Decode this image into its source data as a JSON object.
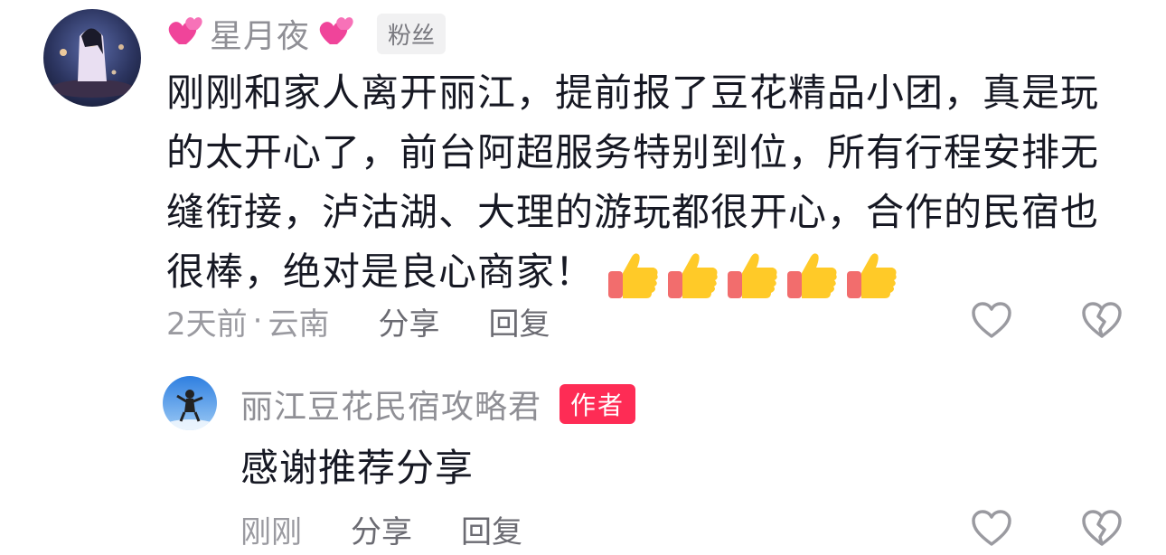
{
  "comment": {
    "username": "星月夜",
    "fan_badge": "粉丝",
    "text": "刚刚和家人离开丽江，提前报了豆花精品小团，真是玩的太开心了，前台阿超服务特别到位，所有行程安排无缝衔接，泸沽湖、大理的游玩都很开心，合作的民宿也很棒，绝对是良心商家！",
    "thumbs_count": 5,
    "time": "2天前",
    "location_sep": "·",
    "location": "云南",
    "share_label": "分享",
    "reply_label": "回复"
  },
  "reply": {
    "username": "丽江豆花民宿攻略君",
    "author_badge": "作者",
    "text": "感谢推荐分享",
    "time": "刚刚",
    "share_label": "分享",
    "reply_label": "回复"
  },
  "icons": {
    "heart": "two-hearts-icon",
    "thumb": "thumbs-up-icon",
    "like": "heart-outline-icon",
    "dislike": "broken-heart-outline-icon"
  },
  "colors": {
    "author_badge": "#fe2c55",
    "username": "#8f8f95",
    "text": "#161823"
  }
}
